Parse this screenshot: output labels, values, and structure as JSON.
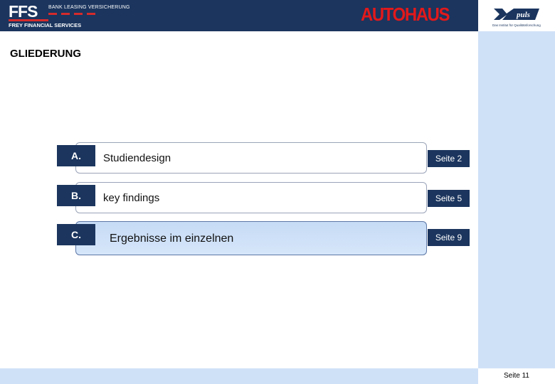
{
  "header": {
    "ffs_mark": "FFS",
    "ffs_tagline": "BANK LEASING VERSICHERUNG",
    "ffs_subtitle": "FREY FINANCIAL SERVICES",
    "autohaus": "AUTOHAUS",
    "puls_logo_text": "puls",
    "puls_tagline": "Das Institut für Qualitätsforschung"
  },
  "title": "GLIEDERUNG",
  "agenda": [
    {
      "letter": "A.",
      "label": "Studiendesign",
      "page": "Seite 2",
      "active": false
    },
    {
      "letter": "B.",
      "label": "key findings",
      "page": "Seite 5",
      "active": false
    },
    {
      "letter": "C.",
      "label": "Ergebnisse im einzelnen",
      "page": "Seite 9",
      "active": true
    }
  ],
  "footer": {
    "page_number": "Seite 11"
  },
  "colors": {
    "navy": "#1b355e",
    "autohaus_red": "#e2191b",
    "light_blue": "#cfe1f7"
  }
}
